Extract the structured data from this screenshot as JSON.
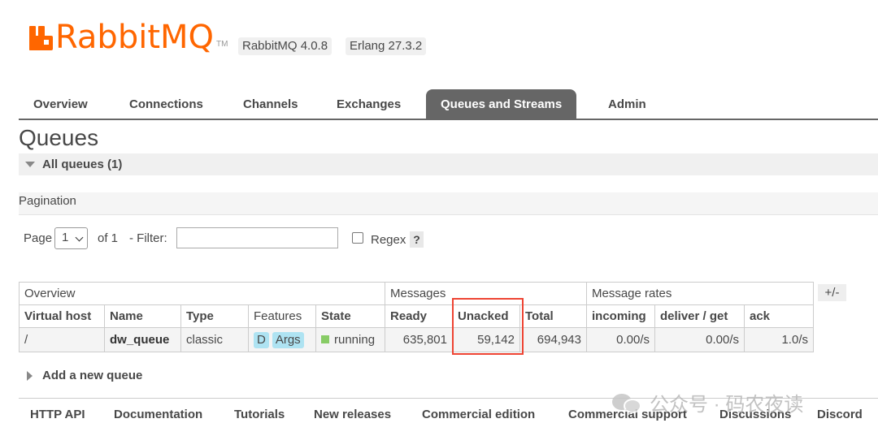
{
  "header": {
    "logo_text": "RabbitMQ",
    "logo_tm": "TM",
    "version": "RabbitMQ 4.0.8",
    "erlang": "Erlang 27.3.2"
  },
  "tabs": [
    {
      "label": "Overview"
    },
    {
      "label": "Connections"
    },
    {
      "label": "Channels"
    },
    {
      "label": "Exchanges"
    },
    {
      "label": "Queues and Streams",
      "active": true
    },
    {
      "label": "Admin"
    }
  ],
  "page_title": "Queues",
  "all_queues_label": "All queues (1)",
  "pagination": {
    "heading": "Pagination",
    "page_label": "Page",
    "page_value": "1",
    "of_label": "of 1",
    "filter_label": "- Filter:",
    "filter_value": "",
    "regex_label": "Regex",
    "help": "?"
  },
  "table": {
    "groups": [
      "Overview",
      "Messages",
      "Message rates"
    ],
    "toggle": "+/-",
    "columns": [
      "Virtual host",
      "Name",
      "Type",
      "Features",
      "State",
      "Ready",
      "Unacked",
      "Total",
      "incoming",
      "deliver / get",
      "ack"
    ],
    "rows": [
      {
        "vhost": "/",
        "name": "dw_queue",
        "type": "classic",
        "features": [
          "D",
          "Args"
        ],
        "state": "running",
        "ready": "635,801",
        "unacked": "59,142",
        "total": "694,943",
        "incoming": "0.00/s",
        "deliver_get": "0.00/s",
        "ack": "1.0/s"
      }
    ]
  },
  "add_queue": "Add a new queue",
  "footer": [
    "HTTP API",
    "Documentation",
    "Tutorials",
    "New releases",
    "Commercial edition",
    "Commercial support",
    "Discussions",
    "Discord"
  ],
  "watermark": "公众号 · 码农夜读",
  "colors": {
    "brand": "#ff6600",
    "active_tab": "#666666",
    "badge": "#aee3f2",
    "running": "#88cc66",
    "highlight": "#ee4433"
  }
}
